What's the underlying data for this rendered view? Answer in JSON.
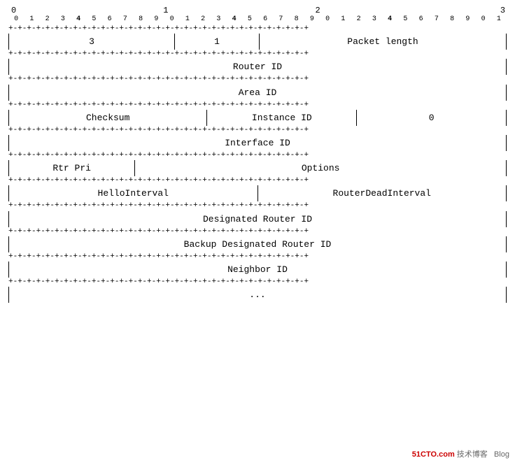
{
  "ruler": {
    "majors": [
      "0",
      "1",
      "2",
      "3"
    ],
    "minor_row1": [
      "0",
      "1",
      "2",
      "3",
      "4",
      "5",
      "6",
      "7",
      "8",
      "9",
      "0",
      "1",
      "2",
      "3",
      "4",
      "5",
      "6",
      "7",
      "8",
      "9",
      "0",
      "1",
      "2",
      "3",
      "4",
      "5",
      "6",
      "7",
      "8",
      "9",
      "0",
      "1"
    ],
    "minor_bold": [
      4,
      14,
      24
    ]
  },
  "divider": "+-+-+-+-+-+-+-+-+-+-+-+-+-+-+-+-+-+-+-+-+-+-+-+-+-+-+-+-+-+-+-+-+",
  "fields": {
    "header_3": "3",
    "header_1": "1",
    "packet_length": "Packet length",
    "router_id": "Router ID",
    "area_id": "Area ID",
    "checksum": "Checksum",
    "instance_id": "Instance ID",
    "zero": "0",
    "interface_id": "Interface ID",
    "rtr_pri": "Rtr Pri",
    "options": "Options",
    "hello_interval": "HelloInterval",
    "router_dead_interval": "RouterDeadInterval",
    "designated_router_id": "Designated Router ID",
    "backup_designated_router_id": "Backup Designated Router ID",
    "neighbor_id": "Neighbor ID",
    "ellipsis": "..."
  },
  "watermark": {
    "site": "51CTO.com",
    "label": "技术博客",
    "blog": "Blog"
  }
}
